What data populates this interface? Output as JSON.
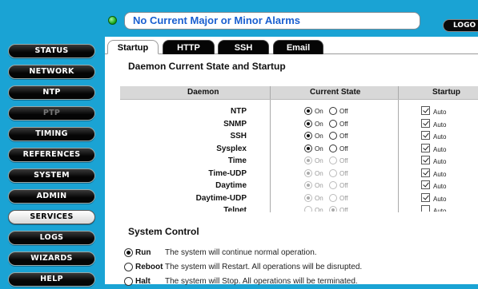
{
  "header": {
    "alarm_text": "No Current Major or Minor Alarms",
    "logout_label": "LOGO"
  },
  "sidebar": {
    "items": [
      {
        "label": "STATUS",
        "state": "normal"
      },
      {
        "label": "NETWORK",
        "state": "normal"
      },
      {
        "label": "NTP",
        "state": "normal"
      },
      {
        "label": "PTP",
        "state": "disabled"
      },
      {
        "label": "TIMING",
        "state": "normal"
      },
      {
        "label": "REFERENCES",
        "state": "normal"
      },
      {
        "label": "SYSTEM",
        "state": "normal"
      },
      {
        "label": "ADMIN",
        "state": "normal"
      },
      {
        "label": "SERVICES",
        "state": "active"
      },
      {
        "label": "LOGS",
        "state": "normal"
      },
      {
        "label": "WIZARDS",
        "state": "normal"
      },
      {
        "label": "HELP",
        "state": "normal"
      }
    ]
  },
  "tabs": [
    {
      "label": "Startup",
      "active": true
    },
    {
      "label": "HTTP",
      "active": false
    },
    {
      "label": "SSH",
      "active": false
    },
    {
      "label": "Email",
      "active": false
    }
  ],
  "daemon_section": {
    "title": "Daemon Current State and Startup",
    "columns": [
      "Daemon",
      "Current State",
      "Startup"
    ],
    "on_label": "On",
    "off_label": "Off",
    "auto_label": "Auto",
    "rows": [
      {
        "name": "NTP",
        "state": "on",
        "enabled": true,
        "auto": true
      },
      {
        "name": "SNMP",
        "state": "on",
        "enabled": true,
        "auto": true
      },
      {
        "name": "SSH",
        "state": "on",
        "enabled": true,
        "auto": true
      },
      {
        "name": "Sysplex",
        "state": "on",
        "enabled": true,
        "auto": true
      },
      {
        "name": "Time",
        "state": "on",
        "enabled": false,
        "auto": true
      },
      {
        "name": "Time-UDP",
        "state": "on",
        "enabled": false,
        "auto": true
      },
      {
        "name": "Daytime",
        "state": "on",
        "enabled": false,
        "auto": true
      },
      {
        "name": "Daytime-UDP",
        "state": "on",
        "enabled": false,
        "auto": true
      },
      {
        "name": "Telnet",
        "state": "off",
        "enabled": false,
        "auto": false
      }
    ]
  },
  "system_control": {
    "title": "System Control",
    "options": [
      {
        "label": "Run",
        "description": "The system will continue normal operation.",
        "selected": true
      },
      {
        "label": "Reboot",
        "description": "The system will Restart. All operations will be disrupted.",
        "selected": false
      },
      {
        "label": "Halt",
        "description": "The system will Stop. All operations will be terminated.",
        "selected": false
      }
    ]
  },
  "colors": {
    "background": "#1aa3d4",
    "alarm_text": "#1a5fd0",
    "status_led": "#10a010"
  }
}
